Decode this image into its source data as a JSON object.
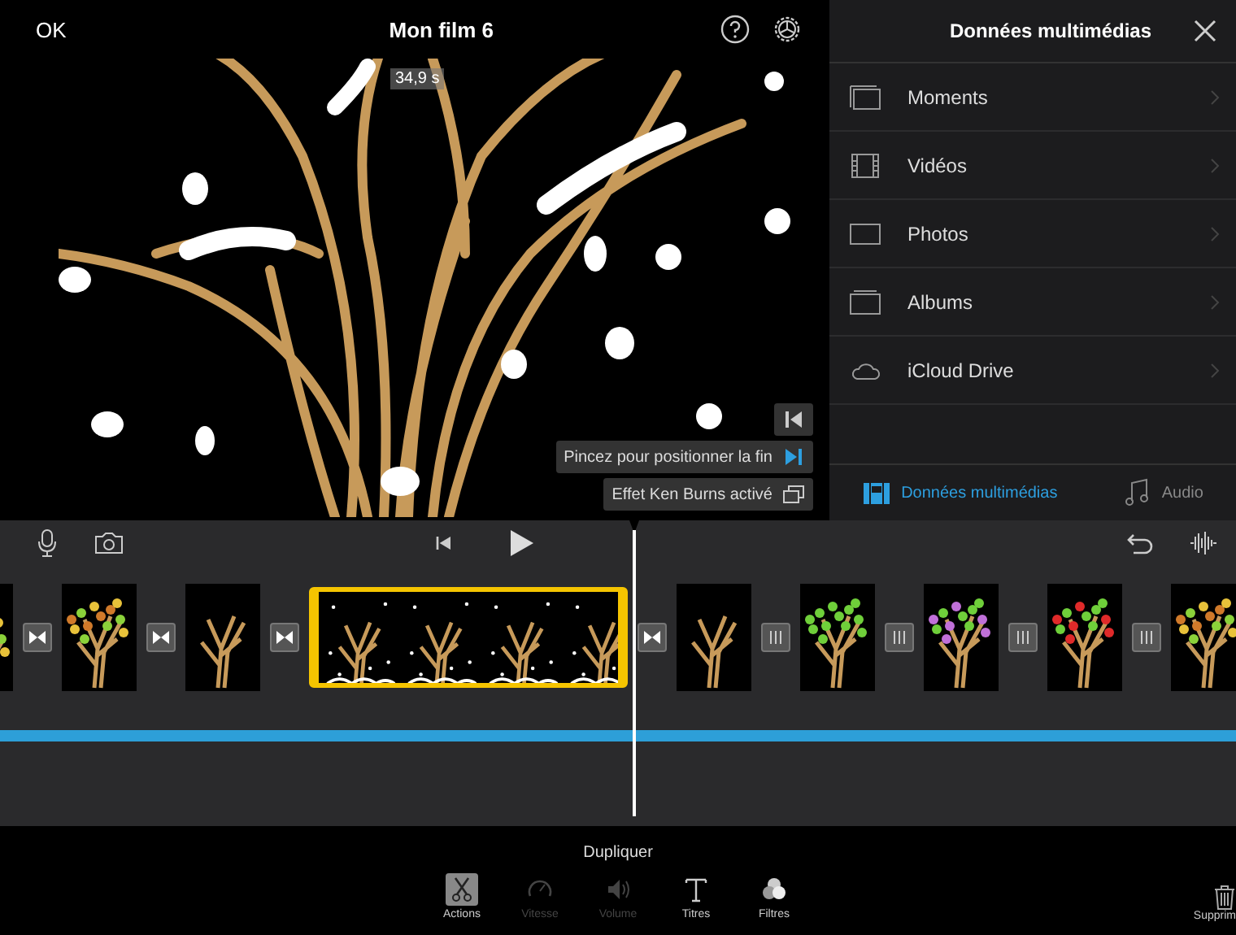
{
  "header": {
    "ok": "OK",
    "title": "Mon film 6"
  },
  "viewer": {
    "time_badge": "34,9 s",
    "controls": [
      {
        "kind": "start",
        "selected": false
      },
      {
        "kind": "end",
        "label": "Pincez pour positionner la fin",
        "selected": true
      },
      {
        "kind": "kenburns",
        "label": "Effet Ken Burns activé",
        "selected": false
      }
    ]
  },
  "media_panel": {
    "title": "Données multimédias",
    "items": [
      {
        "kind": "moments",
        "label": "Moments"
      },
      {
        "kind": "videos",
        "label": "Vidéos"
      },
      {
        "kind": "photos",
        "label": "Photos"
      },
      {
        "kind": "albums",
        "label": "Albums"
      },
      {
        "kind": "cloud",
        "label": "iCloud Drive"
      }
    ],
    "tabs": [
      {
        "kind": "media",
        "label": "Données multimédias",
        "selected": true
      },
      {
        "kind": "audio",
        "label": "Audio",
        "selected": false
      }
    ]
  },
  "timeline": {
    "items": [
      {
        "kind": "autumn",
        "selected": false
      },
      {
        "kind": "crossfade"
      },
      {
        "kind": "autumn",
        "selected": false
      },
      {
        "kind": "crossfade"
      },
      {
        "kind": "bare",
        "selected": false
      },
      {
        "kind": "crossfade"
      },
      {
        "kind": "snow",
        "selected": true
      },
      {
        "kind": "crossfade"
      },
      {
        "kind": "bare",
        "selected": false
      },
      {
        "kind": "cut"
      },
      {
        "kind": "leafy",
        "selected": false
      },
      {
        "kind": "cut"
      },
      {
        "kind": "blossom",
        "selected": false
      },
      {
        "kind": "cut"
      },
      {
        "kind": "fruit",
        "selected": false
      },
      {
        "kind": "cut"
      },
      {
        "kind": "autumn",
        "selected": false
      }
    ]
  },
  "bottom": {
    "action": "Dupliquer",
    "tools": [
      {
        "kind": "actions",
        "label": "Actions",
        "selected": true,
        "disabled": false
      },
      {
        "kind": "speed",
        "label": "Vitesse",
        "selected": false,
        "disabled": true
      },
      {
        "kind": "volume",
        "label": "Volume",
        "selected": false,
        "disabled": true
      },
      {
        "kind": "titles",
        "label": "Titres",
        "selected": false,
        "disabled": false
      },
      {
        "kind": "filters",
        "label": "Filtres",
        "selected": false,
        "disabled": false
      }
    ],
    "delete": "Supprim"
  }
}
